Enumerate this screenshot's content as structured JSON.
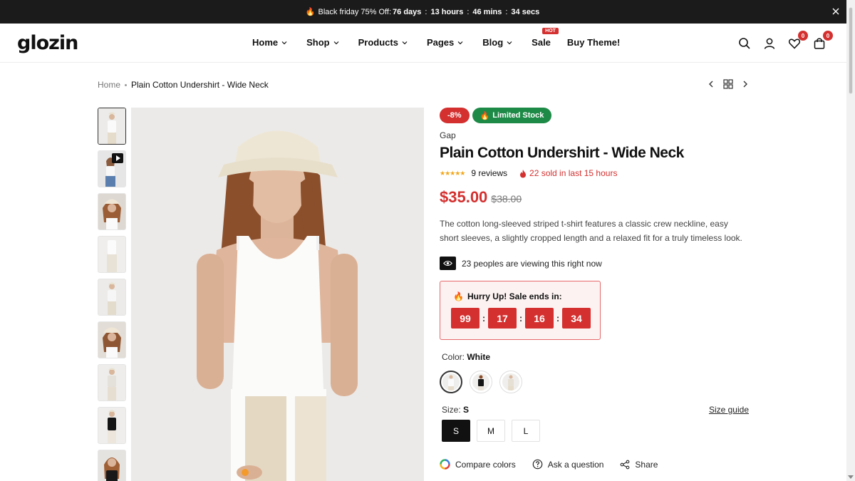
{
  "announcement": {
    "prefix": "Black friday 75% Off:",
    "days": "76 days",
    "hours": "13 hours",
    "mins": "46 mins",
    "secs": "34 secs"
  },
  "header": {
    "logo": "glozin",
    "nav": [
      {
        "label": "Home"
      },
      {
        "label": "Shop"
      },
      {
        "label": "Products"
      },
      {
        "label": "Pages"
      },
      {
        "label": "Blog"
      },
      {
        "label": "Sale"
      },
      {
        "label": "Buy Theme!"
      }
    ],
    "hot_badge": "HOT",
    "wishlist_count": "0",
    "cart_count": "0"
  },
  "breadcrumb": {
    "home": "Home",
    "current": "Plain Cotton Undershirt - Wide Neck"
  },
  "product": {
    "discount_badge": "-8%",
    "stock_badge": "Limited Stock",
    "vendor": "Gap",
    "title": "Plain Cotton Undershirt - Wide Neck",
    "stars": "★★★★★",
    "reviews": "9 reviews",
    "sold": "22 sold in last 15 hours",
    "price": "$35.00",
    "compare_price": "$38.00",
    "description": "The cotton long-sleeved striped t-shirt features a classic crew neckline, easy short sleeves, a slightly cropped length and a relaxed fit for a truly timeless look.",
    "viewing": "23 peoples are viewing this right now",
    "hurry_label": "Hurry Up! Sale ends in:",
    "countdown": {
      "days": "99",
      "hours": "17",
      "mins": "16",
      "secs": "34"
    },
    "color_label": "Color:",
    "color_value": "White",
    "size_label": "Size:",
    "size_value": "S",
    "size_guide": "Size guide",
    "sizes": [
      "S",
      "M",
      "L"
    ],
    "compare_colors": "Compare colors",
    "ask_question": "Ask a question",
    "share": "Share"
  },
  "colors": {
    "accent_red": "#d3302f",
    "stock_green": "#1e8a47",
    "topbar_bg": "#1b1b1b"
  }
}
